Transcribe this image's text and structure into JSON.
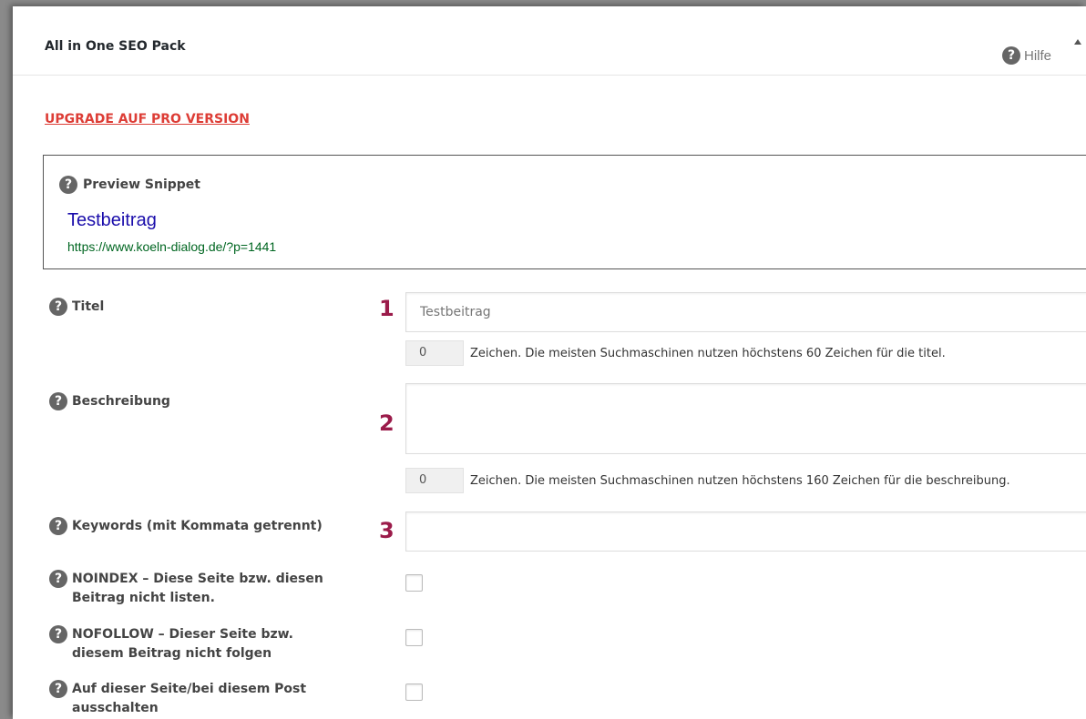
{
  "header": {
    "title": "All in One SEO Pack",
    "help_label": "Hilfe"
  },
  "upgrade_link": "UPGRADE AUF PRO VERSION",
  "snippet": {
    "label": "Preview Snippet",
    "title": "Testbeitrag",
    "url": "https://www.koeln-dialog.de/?p=1441"
  },
  "fields": {
    "title": {
      "label": "Titel",
      "number": "1",
      "placeholder": "Testbeitrag",
      "value": "",
      "counter": "0",
      "hint": "Zeichen. Die meisten Suchmaschinen nutzen höchstens 60 Zeichen für die titel."
    },
    "description": {
      "label": "Beschreibung",
      "number": "2",
      "value": "",
      "counter": "0",
      "hint": "Zeichen. Die meisten Suchmaschinen nutzen höchstens 160 Zeichen für die beschreibung."
    },
    "keywords": {
      "label": "Keywords (mit Kommata getrennt)",
      "number": "3",
      "value": ""
    },
    "noindex": {
      "label_line1": "NOINDEX – Diese Seite bzw. diesen",
      "label_line2": "Beitrag nicht listen.",
      "checked": false
    },
    "nofollow": {
      "label_line1": "NOFOLLOW – Dieser Seite bzw.",
      "label_line2": "diesem Beitrag nicht folgen",
      "checked": false
    },
    "disable": {
      "label_line1": "Auf dieser Seite/bei diesem Post",
      "label_line2": "ausschalten",
      "checked": false
    }
  },
  "icons": {
    "help": "question-circle-icon",
    "collapse": "triangle-up-icon"
  }
}
